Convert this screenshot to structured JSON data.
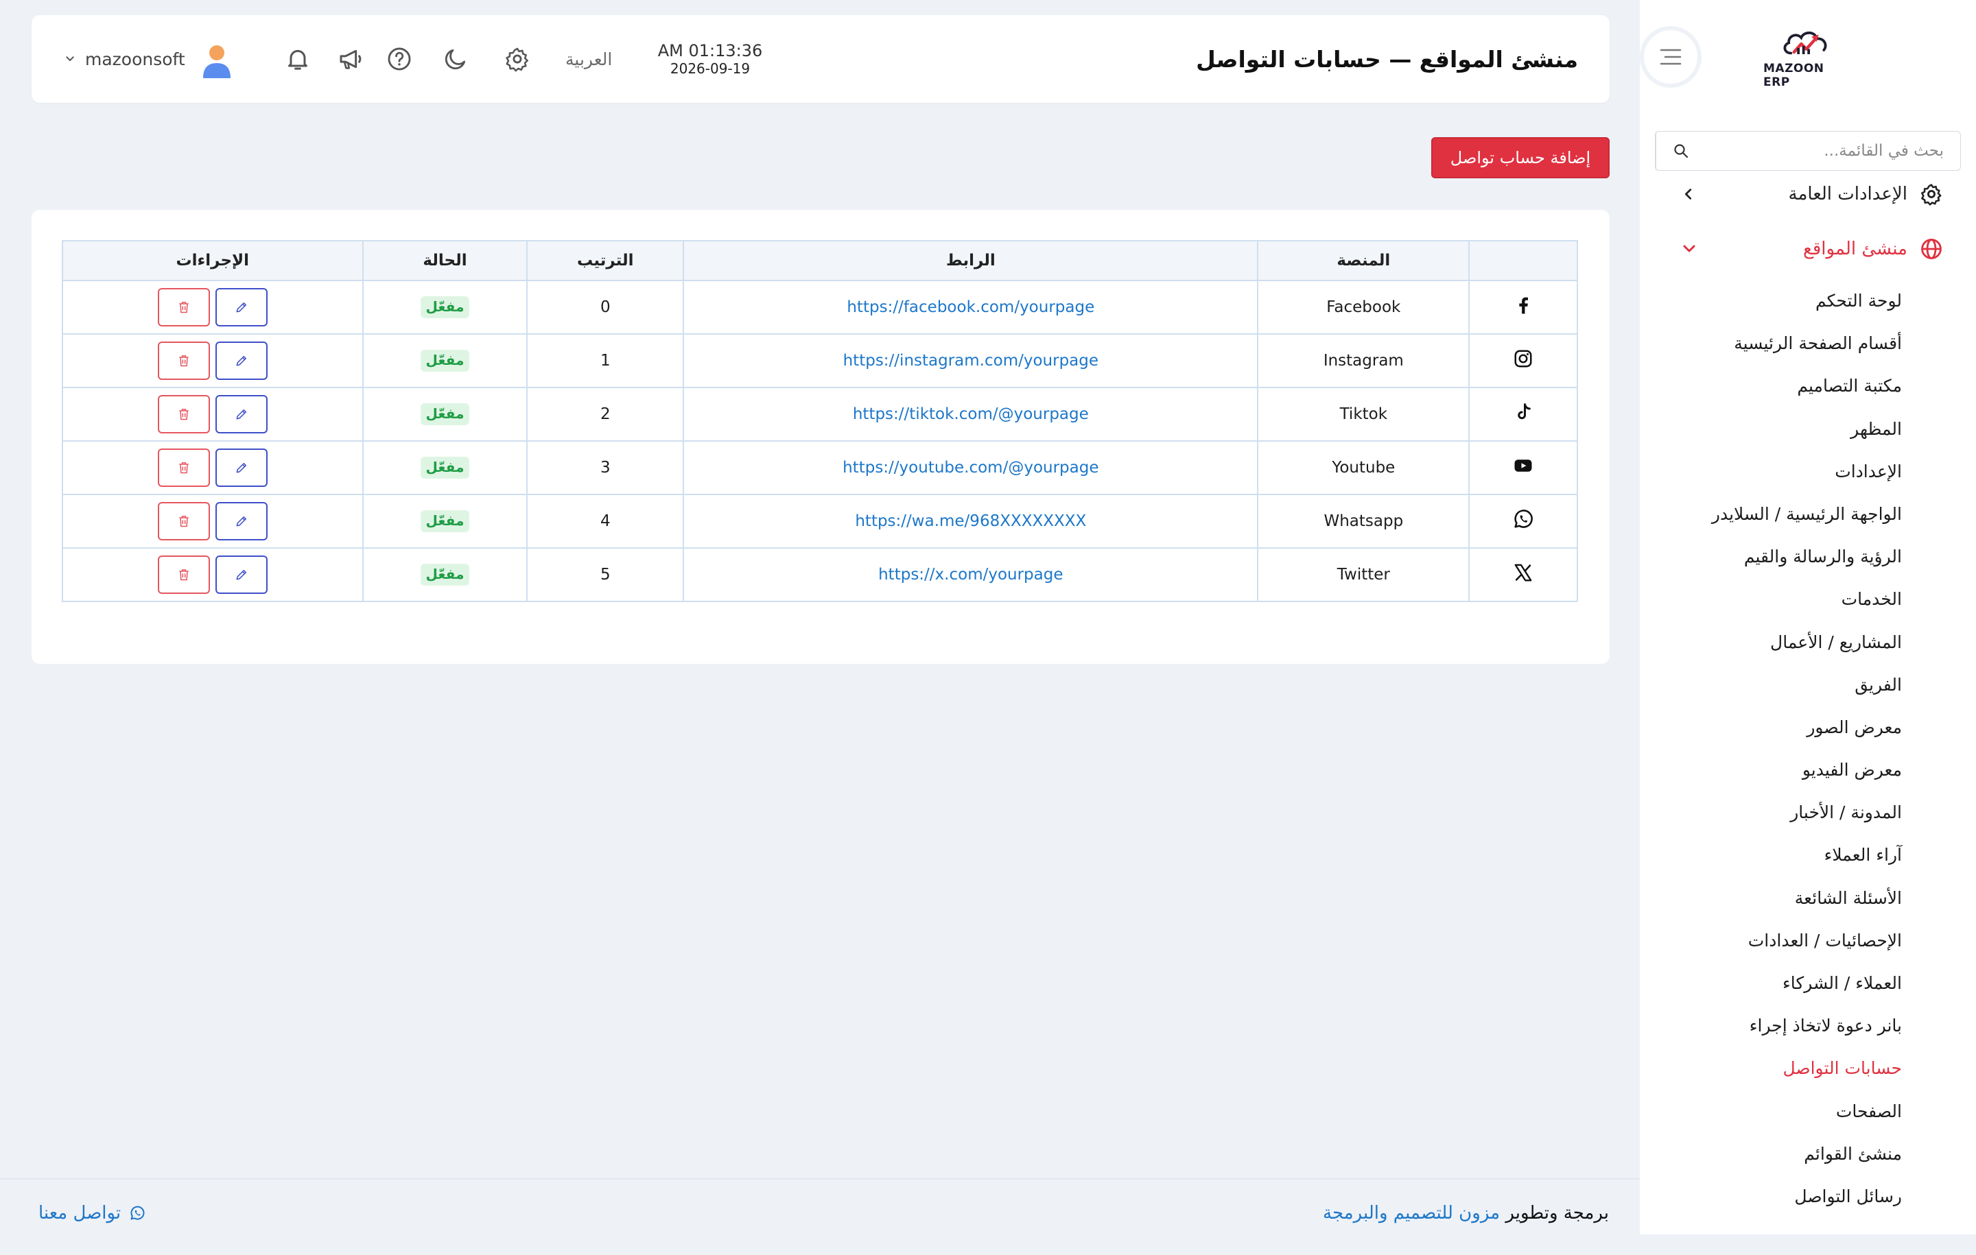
{
  "sidebar": {
    "logo_text": "MAZOON ERP",
    "search_placeholder": "بحث في القائمة...",
    "group_general": "الإعدادات العامة",
    "group_sites": "منشئ المواقع",
    "items": [
      {
        "label": "لوحة التحكم"
      },
      {
        "label": "أقسام الصفحة الرئيسية"
      },
      {
        "label": "مكتبة التصاميم"
      },
      {
        "label": "المظهر"
      },
      {
        "label": "الإعدادات"
      },
      {
        "label": "الواجهة الرئيسية / السلايدر"
      },
      {
        "label": "الرؤية والرسالة والقيم"
      },
      {
        "label": "الخدمات"
      },
      {
        "label": "المشاريع / الأعمال"
      },
      {
        "label": "الفريق"
      },
      {
        "label": "معرض الصور"
      },
      {
        "label": "معرض الفيديو"
      },
      {
        "label": "المدونة / الأخبار"
      },
      {
        "label": "آراء العملاء"
      },
      {
        "label": "الأسئلة الشائعة"
      },
      {
        "label": "الإحصائيات / العدادات"
      },
      {
        "label": "العملاء / الشركاء"
      },
      {
        "label": "بانر دعوة لاتخاذ إجراء"
      },
      {
        "label": "حسابات التواصل",
        "current": true
      },
      {
        "label": "الصفحات"
      },
      {
        "label": "منشئ القوائم"
      },
      {
        "label": "رسائل التواصل"
      }
    ]
  },
  "header": {
    "title": "منشئ المواقع — حسابات التواصل",
    "time": "AM 01:13:36",
    "date": "2026-09-19",
    "language": "العربية",
    "username": "mazoonsoft"
  },
  "add_button": "إضافة حساب تواصل",
  "table": {
    "headers": {
      "icon": "",
      "platform": "المنصة",
      "link": "الرابط",
      "order": "الترتيب",
      "status": "الحالة",
      "actions": "الإجراءات"
    },
    "rows": [
      {
        "icon": "facebook-icon",
        "platform": "Facebook",
        "link": "https://facebook.com/yourpage",
        "order": "0",
        "status": "مفعّل"
      },
      {
        "icon": "instagram-icon",
        "platform": "Instagram",
        "link": "https://instagram.com/yourpage",
        "order": "1",
        "status": "مفعّل"
      },
      {
        "icon": "tiktok-icon",
        "platform": "Tiktok",
        "link": "https://tiktok.com/@yourpage",
        "order": "2",
        "status": "مفعّل"
      },
      {
        "icon": "youtube-icon",
        "platform": "Youtube",
        "link": "https://youtube.com/@yourpage",
        "order": "3",
        "status": "مفعّل"
      },
      {
        "icon": "whatsapp-icon",
        "platform": "Whatsapp",
        "link": "https://wa.me/968XXXXXXXX",
        "order": "4",
        "status": "مفعّل"
      },
      {
        "icon": "x-twitter-icon",
        "platform": "Twitter",
        "link": "https://x.com/yourpage",
        "order": "5",
        "status": "مفعّل"
      }
    ]
  },
  "footer": {
    "credit_prefix": "برمجة وتطوير",
    "credit_brand": "مزون للتصميم والبرمجة",
    "contact": "تواصل معنا"
  },
  "colors": {
    "accent": "#e03140",
    "link": "#1d77c9",
    "badge_bg": "#dff5e4",
    "badge_text": "#1f9d45",
    "background": "#eef1f6"
  }
}
